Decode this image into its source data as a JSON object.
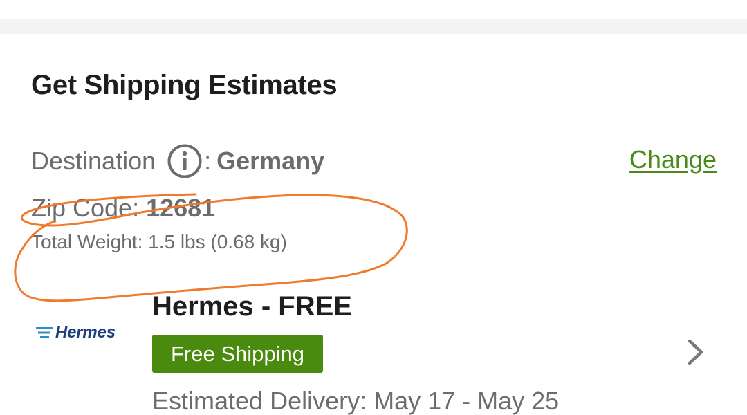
{
  "shipping": {
    "title": "Get Shipping Estimates",
    "destination_label": "Destination",
    "destination_separator": ":",
    "destination_value": "Germany",
    "change_link": "Change",
    "zip_label": "Zip Code:",
    "zip_value": "12681",
    "total_weight": "Total Weight: 1.5 lbs (0.68 kg)"
  },
  "carrier": {
    "logo_text": "Hermes",
    "title": "Hermes  - FREE",
    "badge": "Free Shipping",
    "estimated_delivery": "Estimated Delivery: May 17 - May 25"
  },
  "icons": {
    "info": "info-icon",
    "chevron": "chevron-right-icon",
    "logo": "hermes-logo-icon"
  },
  "colors": {
    "accent_green": "#4a8a0e",
    "link_green": "#4a8a1a",
    "annotation_orange": "#f07a2a",
    "logo_blue": "#1d3e7e"
  }
}
